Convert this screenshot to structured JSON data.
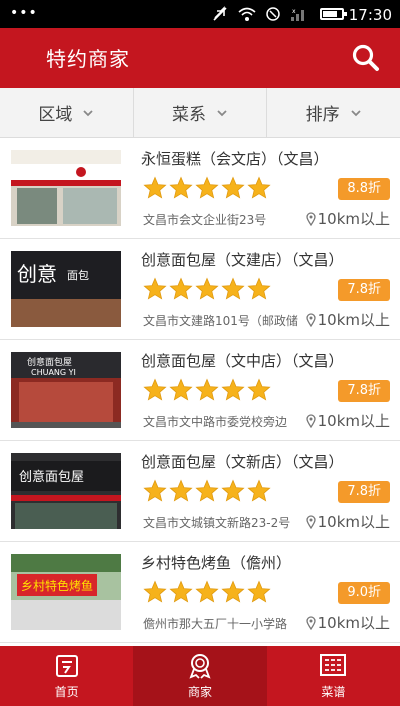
{
  "status_bar": {
    "dots": "•••",
    "time": "17:30",
    "battery_level": 0.8
  },
  "header": {
    "title": "特约商家",
    "search_icon": "search-icon"
  },
  "filters": [
    {
      "label": "区域"
    },
    {
      "label": "菜系"
    },
    {
      "label": "排序"
    }
  ],
  "shops": [
    {
      "name": "永恒蛋糕（会文店）（文昌）",
      "rating": 5,
      "discount": "8.8折",
      "address": "文昌市会文企业街23号",
      "distance": "10km以上"
    },
    {
      "name": "创意面包屋（文建店）（文昌）",
      "rating": 5,
      "discount": "7.8折",
      "address": "文昌市文建路101号（邮政储",
      "distance": "10km以上"
    },
    {
      "name": "创意面包屋（文中店）（文昌）",
      "rating": 5,
      "discount": "7.8折",
      "address": "文昌市文中路市委党校旁边",
      "distance": "10km以上"
    },
    {
      "name": "创意面包屋（文新店）（文昌）",
      "rating": 5,
      "discount": "7.8折",
      "address": "文昌市文城镇文新路23-2号",
      "distance": "10km以上"
    },
    {
      "name": "乡村特色烤鱼（儋州）",
      "rating": 5,
      "discount": "9.0折",
      "address": "儋州市那大五厂十一小学路",
      "distance": "10km以上"
    }
  ],
  "tabs": [
    {
      "label": "首页",
      "icon": "home-icon"
    },
    {
      "label": "商家",
      "icon": "merchant-icon"
    },
    {
      "label": "菜谱",
      "icon": "menu-icon"
    }
  ],
  "colors": {
    "primary": "#c4161f",
    "discount": "#f49a2a",
    "star": "#f6b21b"
  }
}
